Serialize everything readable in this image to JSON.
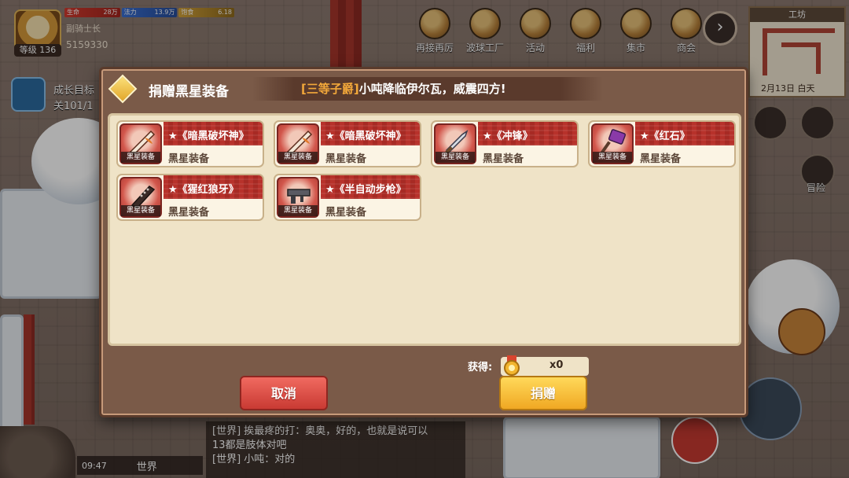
{
  "player": {
    "level": "等级 136",
    "hp_label": "生命",
    "hp_value": "28万",
    "mp_label": "法力",
    "mp_value": "13.9万",
    "hunger_label": "饱食",
    "hunger_value": "6.18",
    "rank": "副骑士长",
    "money": "5159330"
  },
  "goal": {
    "title": "成长目标",
    "progress": "关101/1"
  },
  "top_menu": [
    {
      "label": "再接再厉",
      "icon": "reward-icon"
    },
    {
      "label": "波球工厂",
      "icon": "factory-icon"
    },
    {
      "label": "活动",
      "icon": "event-icon"
    },
    {
      "label": "福利",
      "icon": "gift-icon"
    },
    {
      "label": "集市",
      "icon": "market-icon"
    },
    {
      "label": "商会",
      "icon": "guild-icon"
    }
  ],
  "minimap": {
    "title": "工坊",
    "date": "2月13日",
    "period": "白天"
  },
  "side": {
    "adventure": "冒险"
  },
  "dialog": {
    "title": "捐赠黑星装备",
    "announce_tag": "[三等子爵]",
    "announce_text": "小吨降临伊尔瓦，威震四方!",
    "items": [
      {
        "name": "★《暗黑破坏神》",
        "type": "黑星装备",
        "tag": "黑星装备",
        "icon": "flame-sword-icon"
      },
      {
        "name": "★《暗黑破坏神》",
        "type": "黑星装备",
        "tag": "黑星装备",
        "icon": "flame-sword-icon"
      },
      {
        "name": "★《冲锋》",
        "type": "黑星装备",
        "tag": "黑星装备",
        "icon": "broadsword-icon"
      },
      {
        "name": "★《红石》",
        "type": "黑星装备",
        "tag": "黑星装备",
        "icon": "hammer-icon"
      },
      {
        "name": "★《猩红狼牙》",
        "type": "黑星装备",
        "tag": "黑星装备",
        "icon": "spiked-club-icon"
      },
      {
        "name": "★《半自动步枪》",
        "type": "黑星装备",
        "tag": "黑星装备",
        "icon": "rifle-icon"
      }
    ],
    "gain_label": "获得:",
    "gain_count": "x0",
    "cancel_label": "取消",
    "donate_label": "捐赠"
  },
  "chat": {
    "line1": "[世界] 挨最疼的打：奥奥，好的，也就是说可以",
    "line2": "13都是肢体对吧",
    "line3": "[世界] 小吨：对的",
    "time": "09:47",
    "channel": "世界"
  },
  "colors": {
    "accent_red": "#b7322b",
    "gold": "#f0a823",
    "panel_bg": "#efe3c7"
  }
}
